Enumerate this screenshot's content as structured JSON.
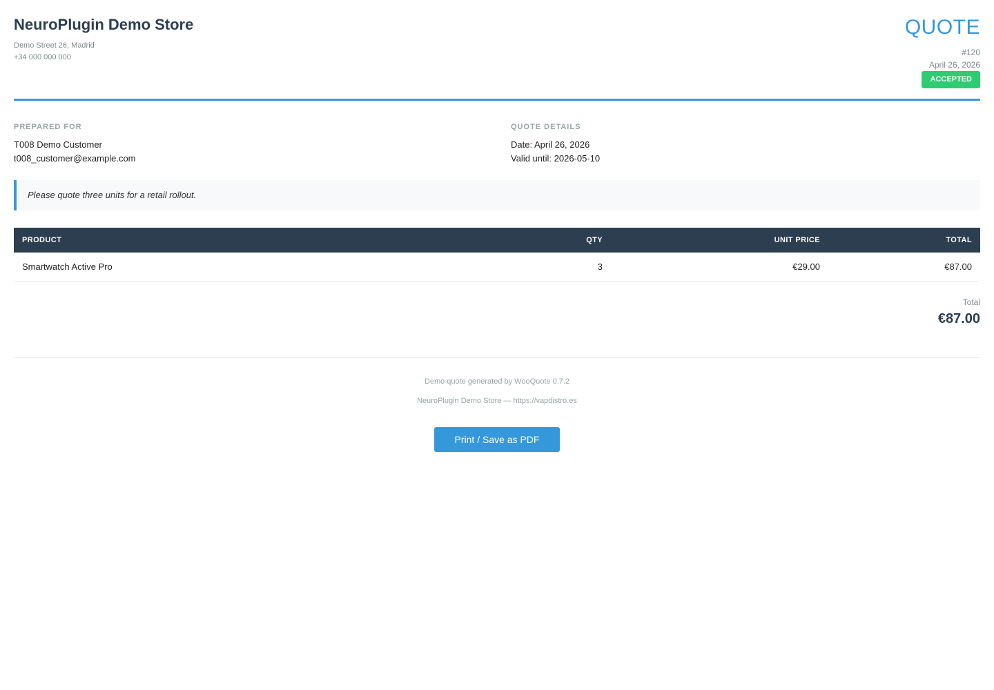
{
  "store": {
    "name": "NeuroPlugin Demo Store",
    "address": "Demo Street 26, Madrid",
    "phone": "+34 000 000 000"
  },
  "quote": {
    "title": "QUOTE",
    "number": "#120",
    "date": "April 26, 2026",
    "status": "ACCEPTED",
    "status_color": "#2ecc71",
    "accent_color": "#3498db"
  },
  "prepared_for": {
    "label": "PREPARED FOR",
    "name": "T008 Demo Customer",
    "email": "t008_customer@example.com"
  },
  "quote_details": {
    "label": "QUOTE DETAILS",
    "date_line": "Date: April 26, 2026",
    "valid_line": "Valid until: 2026-05-10"
  },
  "note": "Please quote three units for a retail rollout.",
  "table": {
    "headers": [
      "PRODUCT",
      "QTY",
      "UNIT PRICE",
      "TOTAL"
    ],
    "rows": [
      {
        "product": "Smartwatch Active Pro",
        "qty": "3",
        "unit_price": "€29.00",
        "total": "€87.00"
      }
    ]
  },
  "totals": {
    "label": "Total",
    "value": "€87.00"
  },
  "footer": {
    "generated": "Demo quote generated by WooQuote 0.7.2",
    "site": "NeuroPlugin Demo Store — https://vapdistro.es",
    "print_label": "Print / Save as PDF"
  }
}
